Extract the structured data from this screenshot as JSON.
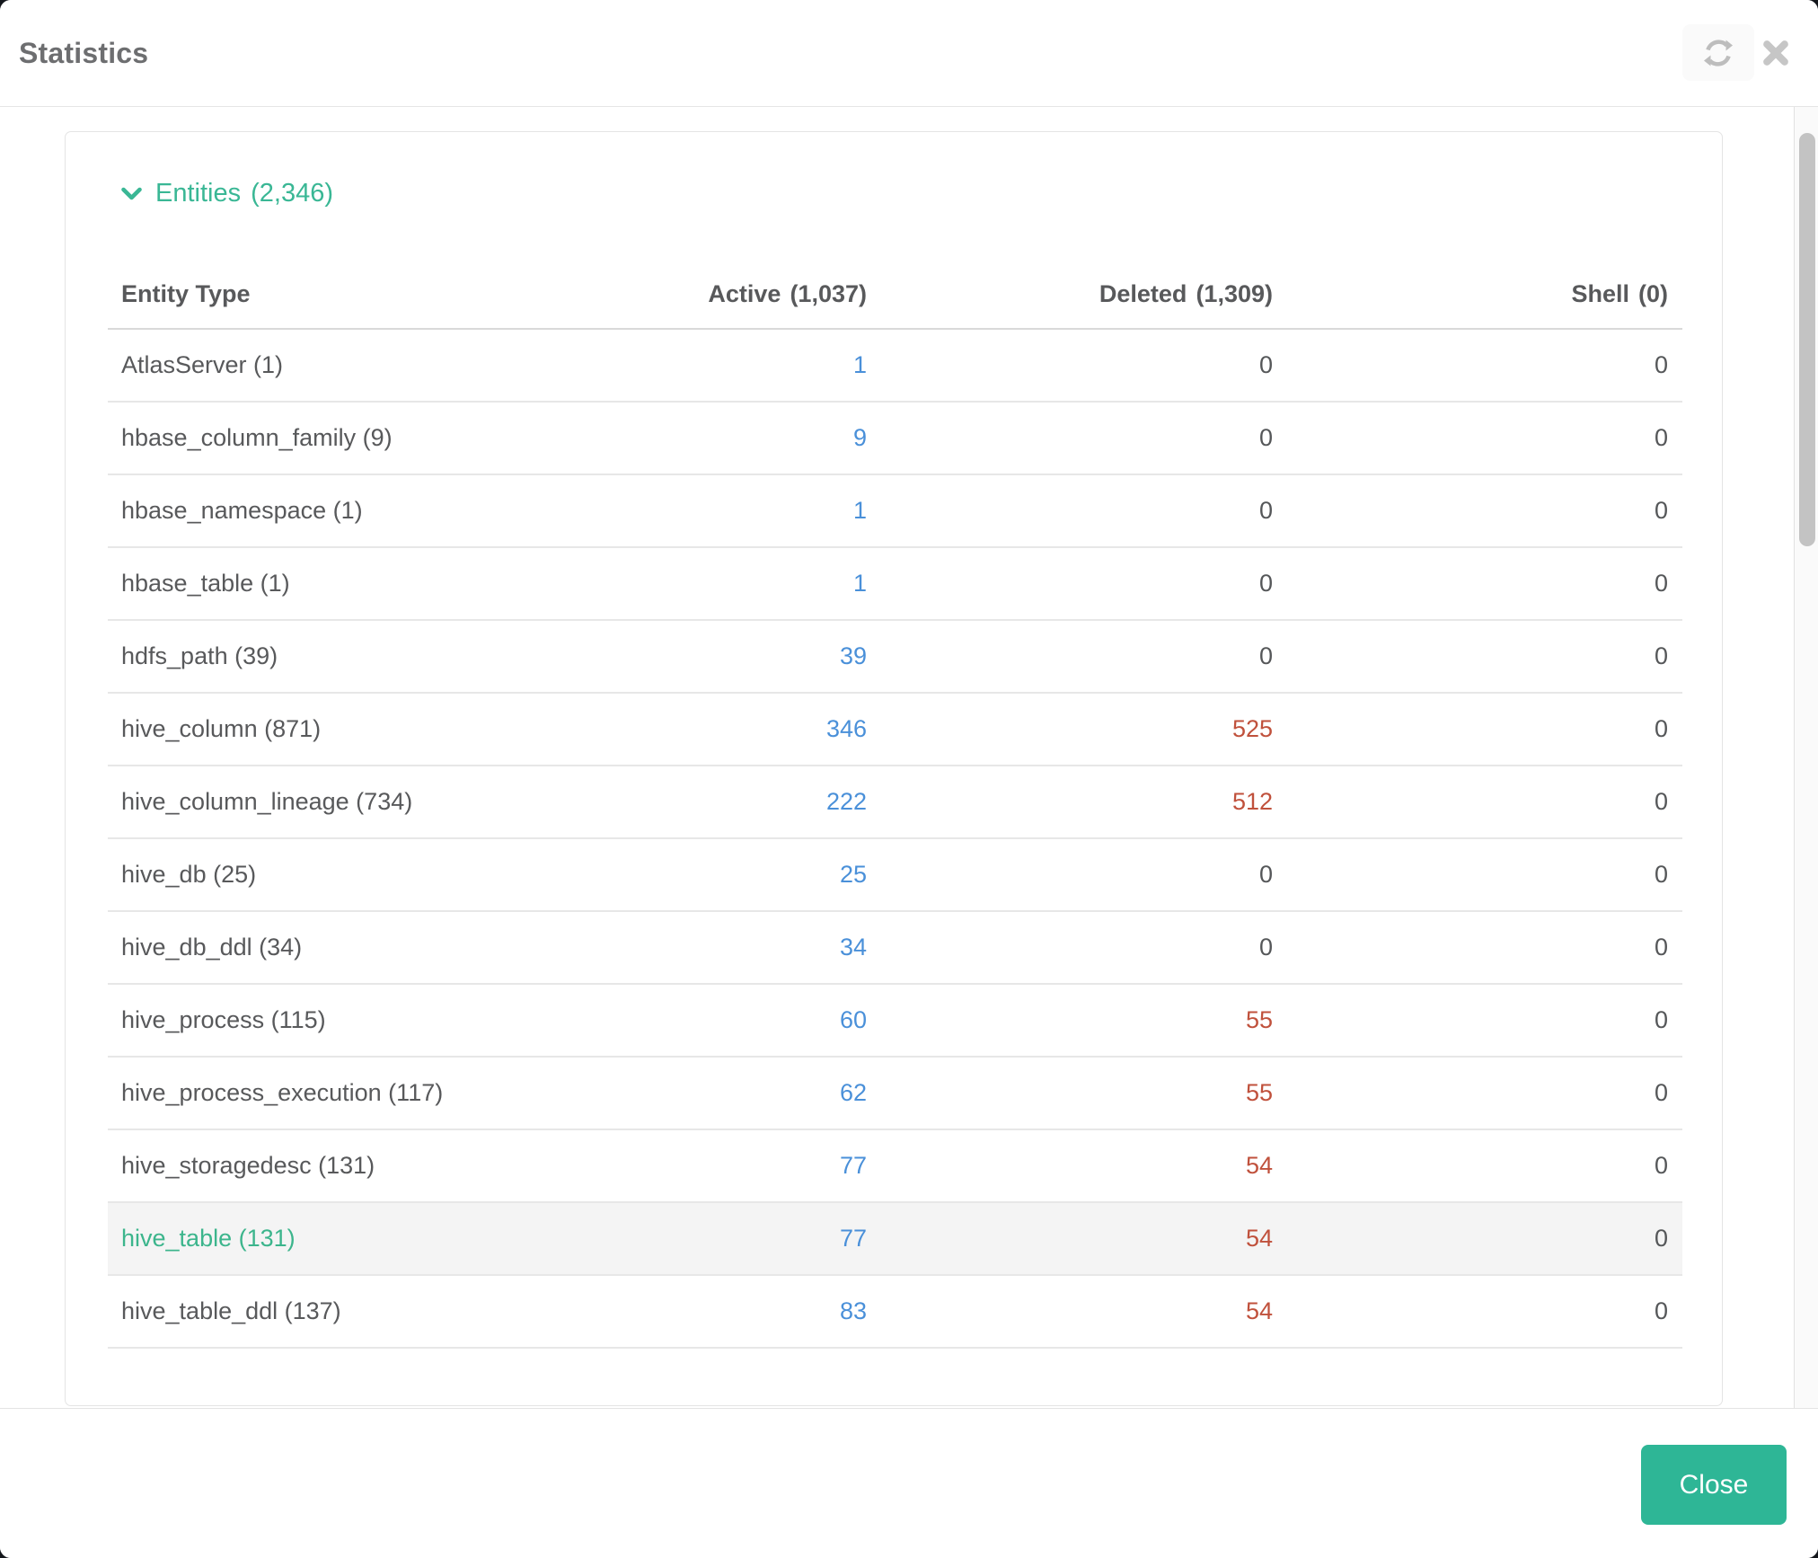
{
  "modal": {
    "title": "Statistics",
    "close_button_label": "Close"
  },
  "icons": {
    "refresh": "refresh-icon",
    "close": "close-icon",
    "chevron": "chevron-down-icon"
  },
  "entities_section": {
    "title": "Entities",
    "count": "(2,346)"
  },
  "table": {
    "columns": [
      {
        "label": "Entity Type",
        "count": ""
      },
      {
        "label": "Active",
        "count": "(1,037)"
      },
      {
        "label": "Deleted",
        "count": "(1,309)"
      },
      {
        "label": "Shell",
        "count": "(0)"
      }
    ],
    "rows": [
      {
        "entity_type": "AtlasServer (1)",
        "active": "1",
        "deleted": "0",
        "shell": "0",
        "highlighted": false
      },
      {
        "entity_type": "hbase_column_family (9)",
        "active": "9",
        "deleted": "0",
        "shell": "0",
        "highlighted": false
      },
      {
        "entity_type": "hbase_namespace (1)",
        "active": "1",
        "deleted": "0",
        "shell": "0",
        "highlighted": false
      },
      {
        "entity_type": "hbase_table (1)",
        "active": "1",
        "deleted": "0",
        "shell": "0",
        "highlighted": false
      },
      {
        "entity_type": "hdfs_path (39)",
        "active": "39",
        "deleted": "0",
        "shell": "0",
        "highlighted": false
      },
      {
        "entity_type": "hive_column (871)",
        "active": "346",
        "deleted": "525",
        "shell": "0",
        "highlighted": false
      },
      {
        "entity_type": "hive_column_lineage (734)",
        "active": "222",
        "deleted": "512",
        "shell": "0",
        "highlighted": false
      },
      {
        "entity_type": "hive_db (25)",
        "active": "25",
        "deleted": "0",
        "shell": "0",
        "highlighted": false
      },
      {
        "entity_type": "hive_db_ddl (34)",
        "active": "34",
        "deleted": "0",
        "shell": "0",
        "highlighted": false
      },
      {
        "entity_type": "hive_process (115)",
        "active": "60",
        "deleted": "55",
        "shell": "0",
        "highlighted": false
      },
      {
        "entity_type": "hive_process_execution (117)",
        "active": "62",
        "deleted": "55",
        "shell": "0",
        "highlighted": false
      },
      {
        "entity_type": "hive_storagedesc (131)",
        "active": "77",
        "deleted": "54",
        "shell": "0",
        "highlighted": false
      },
      {
        "entity_type": "hive_table (131)",
        "active": "77",
        "deleted": "54",
        "shell": "0",
        "highlighted": true
      },
      {
        "entity_type": "hive_table_ddl (137)",
        "active": "83",
        "deleted": "54",
        "shell": "0",
        "highlighted": false
      }
    ]
  },
  "colors": {
    "accent_green": "#3ab795",
    "row_green": "#3cb58c",
    "button_green": "#2eb696",
    "link_blue": "#4a90d9",
    "link_red": "#c0513c",
    "text_dark": "#58595b",
    "icon_gray": "#bdbdbd",
    "close_icon_gray": "#c6c6c6",
    "refresh_btn_bg": "#fafafa",
    "row_highlight_bg": "#f4f4f4",
    "scroll_track": "#fafafa",
    "scroll_thumb": "#c3c3c3",
    "backdrop": "#14171c"
  }
}
